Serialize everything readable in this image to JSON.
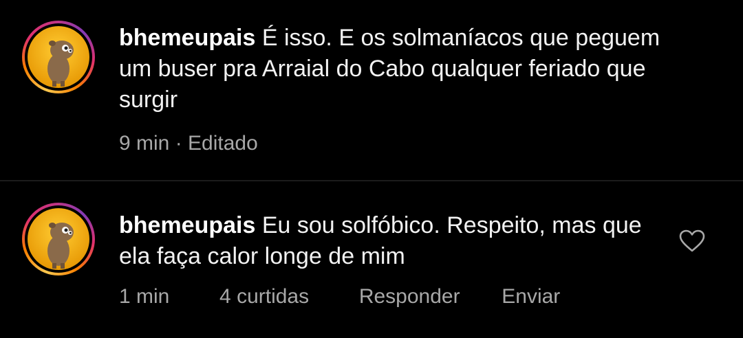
{
  "comments": [
    {
      "username": "bhemeupais",
      "text": "É isso. E os solmaníacos que peguem um buser pra Arraial do Cabo qualquer feriado que surgir",
      "time": "9 min",
      "separator": "·",
      "edited_label": "Editado"
    },
    {
      "username": "bhemeupais",
      "text": "Eu sou solfóbico. Respeito, mas que ela faça calor longe de mim",
      "time": "1 min",
      "likes_label": "4 curtidas",
      "reply_label": "Responder",
      "send_label": "Enviar",
      "like_icon": "heart-outline-icon"
    }
  ],
  "colors": {
    "background": "#000000",
    "text": "#f2f2f2",
    "secondary_text": "#a8a8a8",
    "divider": "#1c1c1c",
    "avatar_ring": [
      "#f9c74f",
      "#f77f00",
      "#e1306c",
      "#c13584"
    ]
  }
}
